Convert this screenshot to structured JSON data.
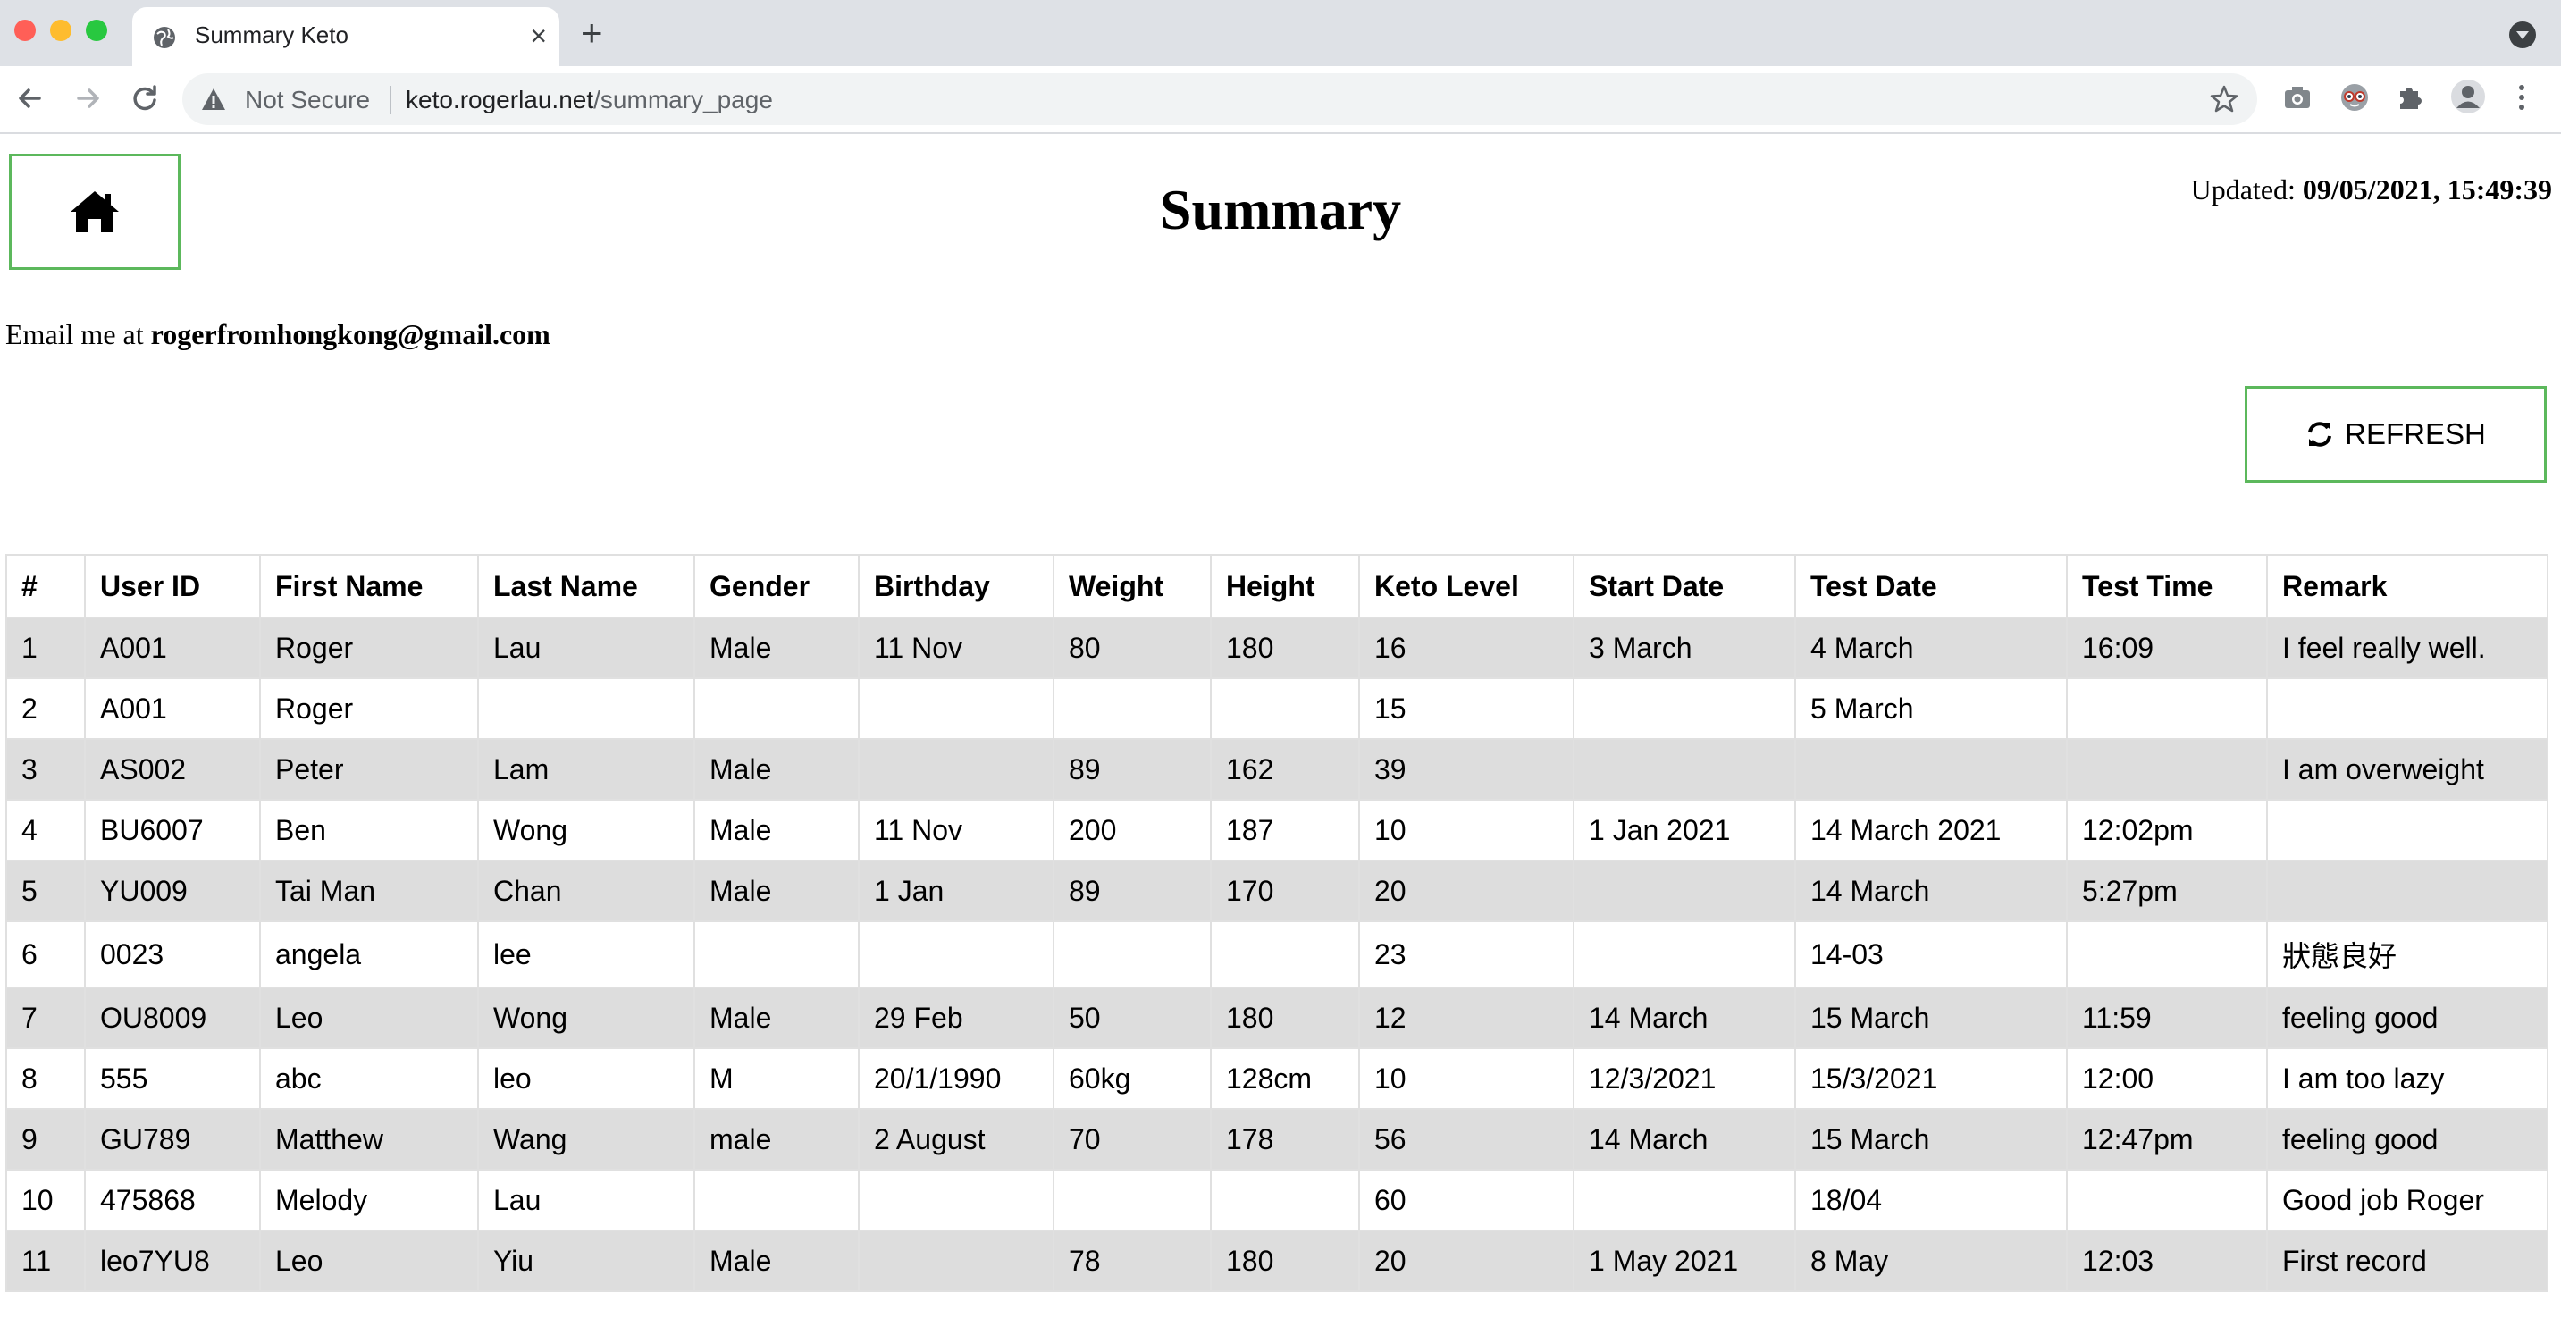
{
  "browser": {
    "tab_title": "Summary Keto",
    "new_tab": "+",
    "close": "×",
    "security_label": "Not Secure",
    "url_host": "keto.rogerlau.net",
    "url_path": "/summary_page"
  },
  "header": {
    "title": "Summary",
    "updated_label": "Updated:",
    "updated_value": "09/05/2021, 15:49:39",
    "email_label": "Email me at",
    "email_value": "rogerfromhongkong@gmail.com",
    "refresh_label": "REFRESH"
  },
  "table": {
    "columns": [
      "#",
      "User ID",
      "First Name",
      "Last Name",
      "Gender",
      "Birthday",
      "Weight",
      "Height",
      "Keto Level",
      "Start Date",
      "Test Date",
      "Test Time",
      "Remark"
    ],
    "rows": [
      [
        "1",
        "A001",
        "Roger",
        "Lau",
        "Male",
        "11 Nov",
        "80",
        "180",
        "16",
        "3 March",
        "4 March",
        "16:09",
        "I feel really well."
      ],
      [
        "2",
        "A001",
        "Roger",
        "",
        "",
        "",
        "",
        "",
        "15",
        "",
        "5 March",
        "",
        ""
      ],
      [
        "3",
        "AS002",
        "Peter",
        "Lam",
        "Male",
        "",
        "89",
        "162",
        "39",
        "",
        "",
        "",
        "I am overweight"
      ],
      [
        "4",
        "BU6007",
        "Ben",
        "Wong",
        "Male",
        "11 Nov",
        "200",
        "187",
        "10",
        "1 Jan 2021",
        "14 March 2021",
        "12:02pm",
        ""
      ],
      [
        "5",
        "YU009",
        "Tai Man",
        "Chan",
        "Male",
        "1 Jan",
        "89",
        "170",
        "20",
        "",
        "14 March",
        "5:27pm",
        ""
      ],
      [
        "6",
        "0023",
        "angela",
        "lee",
        "",
        "",
        "",
        "",
        "23",
        "",
        "14-03",
        "",
        "狀態良好"
      ],
      [
        "7",
        "OU8009",
        "Leo",
        "Wong",
        "Male",
        "29 Feb",
        "50",
        "180",
        "12",
        "14 March",
        "15 March",
        "11:59",
        "feeling good"
      ],
      [
        "8",
        "555",
        "abc",
        "leo",
        "M",
        "20/1/1990",
        "60kg",
        "128cm",
        "10",
        "12/3/2021",
        "15/3/2021",
        "12:00",
        "I am too lazy"
      ],
      [
        "9",
        "GU789",
        "Matthew",
        "Wang",
        "male",
        "2 August",
        "70",
        "178",
        "56",
        "14 March",
        "15 March",
        "12:47pm",
        "feeling good"
      ],
      [
        "10",
        "475868",
        "Melody",
        "Lau",
        "",
        "",
        "",
        "",
        "60",
        "",
        "18/04",
        "",
        "Good job Roger"
      ],
      [
        "11",
        "leo7YU8",
        "Leo",
        "Yiu",
        "Male",
        "",
        "78",
        "180",
        "20",
        "1 May 2021",
        "8 May",
        "12:03",
        "First record"
      ]
    ]
  },
  "colors": {
    "button_border": "#5cb85c",
    "row_stripe": "#dddddd"
  }
}
